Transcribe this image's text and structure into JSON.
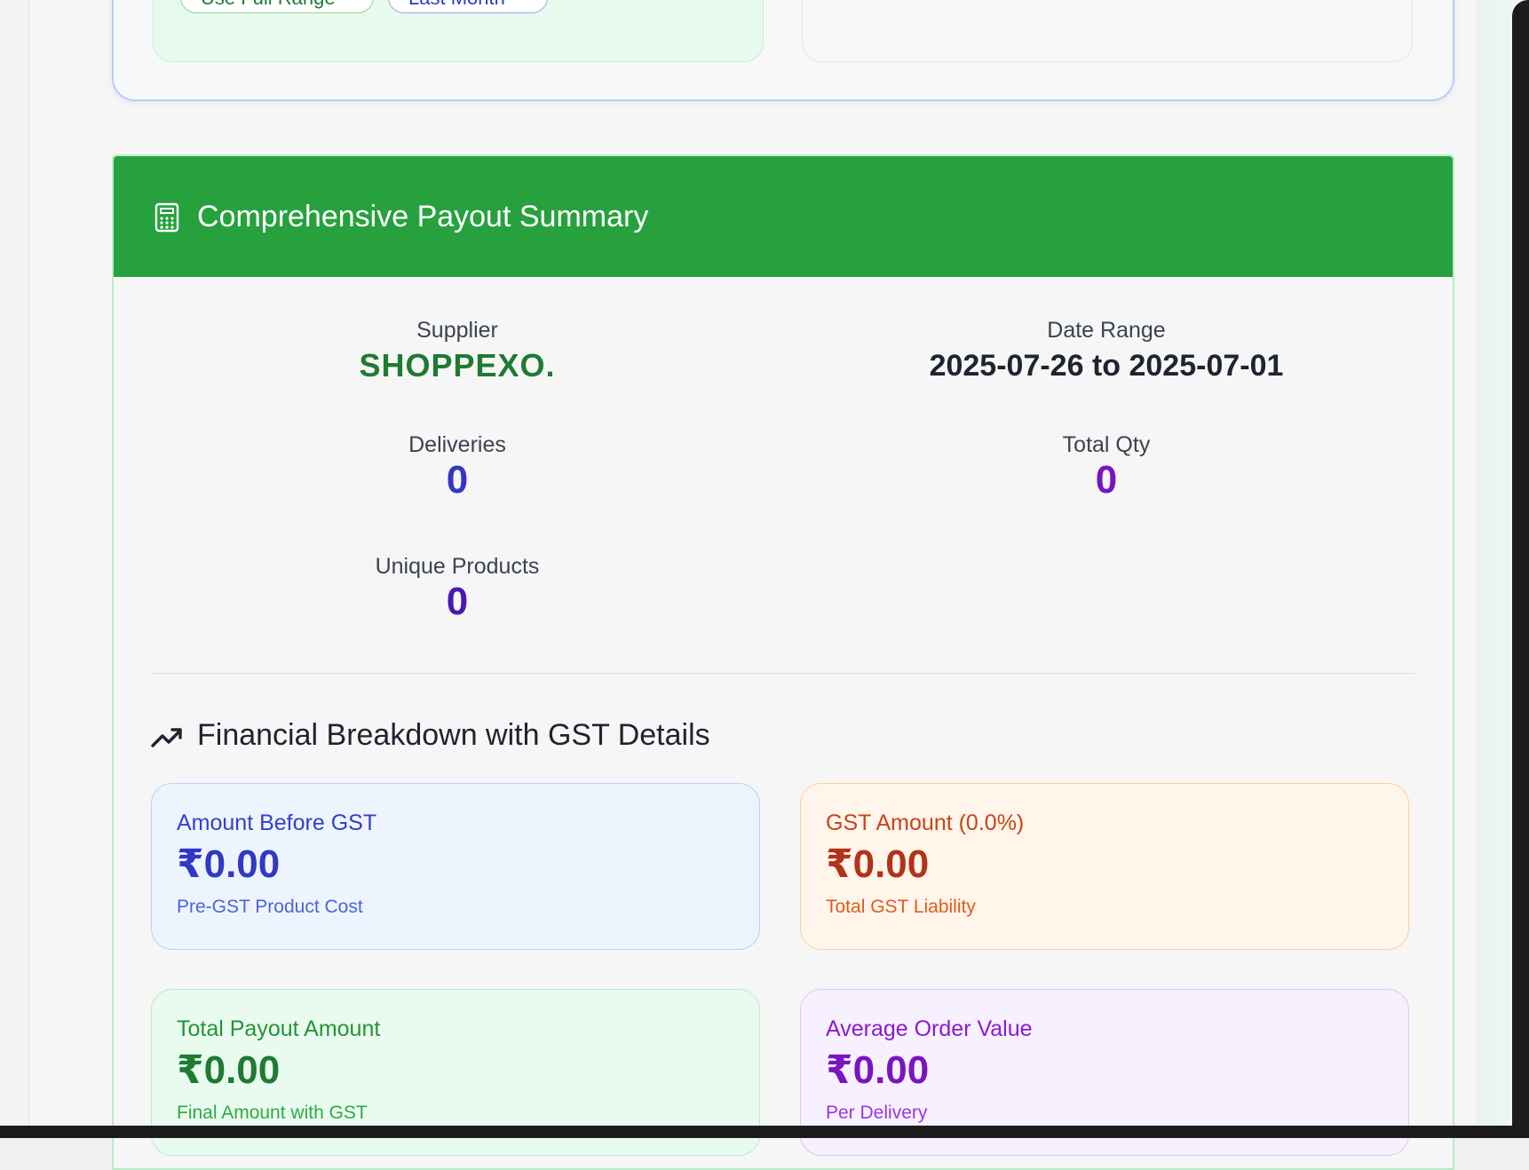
{
  "quick_range": {
    "use_full_range_label": "Use Full Range",
    "last_month_label": "Last Month"
  },
  "summary": {
    "title": "Comprehensive Payout Summary",
    "supplier_label": "Supplier",
    "supplier_value": "SHOPPEXO.",
    "date_range_label": "Date Range",
    "date_range_value": "2025-07-26 to 2025-07-01",
    "deliveries_label": "Deliveries",
    "deliveries_value": "0",
    "total_qty_label": "Total Qty",
    "total_qty_value": "0",
    "unique_products_label": "Unique Products",
    "unique_products_value": "0"
  },
  "financial": {
    "title": "Financial Breakdown with GST Details",
    "cards": [
      {
        "label": "Amount Before GST",
        "value": "₹0.00",
        "sub": "Pre-GST Product Cost"
      },
      {
        "label": "GST Amount (0.0%)",
        "value": "₹0.00",
        "sub": "Total GST Liability"
      },
      {
        "label": "Total Payout Amount",
        "value": "₹0.00",
        "sub": "Final Amount with GST"
      },
      {
        "label": "Average Order Value",
        "value": "₹0.00",
        "sub": "Per Delivery"
      }
    ]
  },
  "colors": {
    "header_green": "#27a13e",
    "supplier_green": "#1f7a33",
    "deliveries_blue": "#3436c4",
    "qty_purple": "#7a12c6",
    "unique_indigo": "#4a18b8"
  },
  "icons": {
    "summary_icon": "calculator-icon",
    "section_icon": "trending-up-icon"
  }
}
